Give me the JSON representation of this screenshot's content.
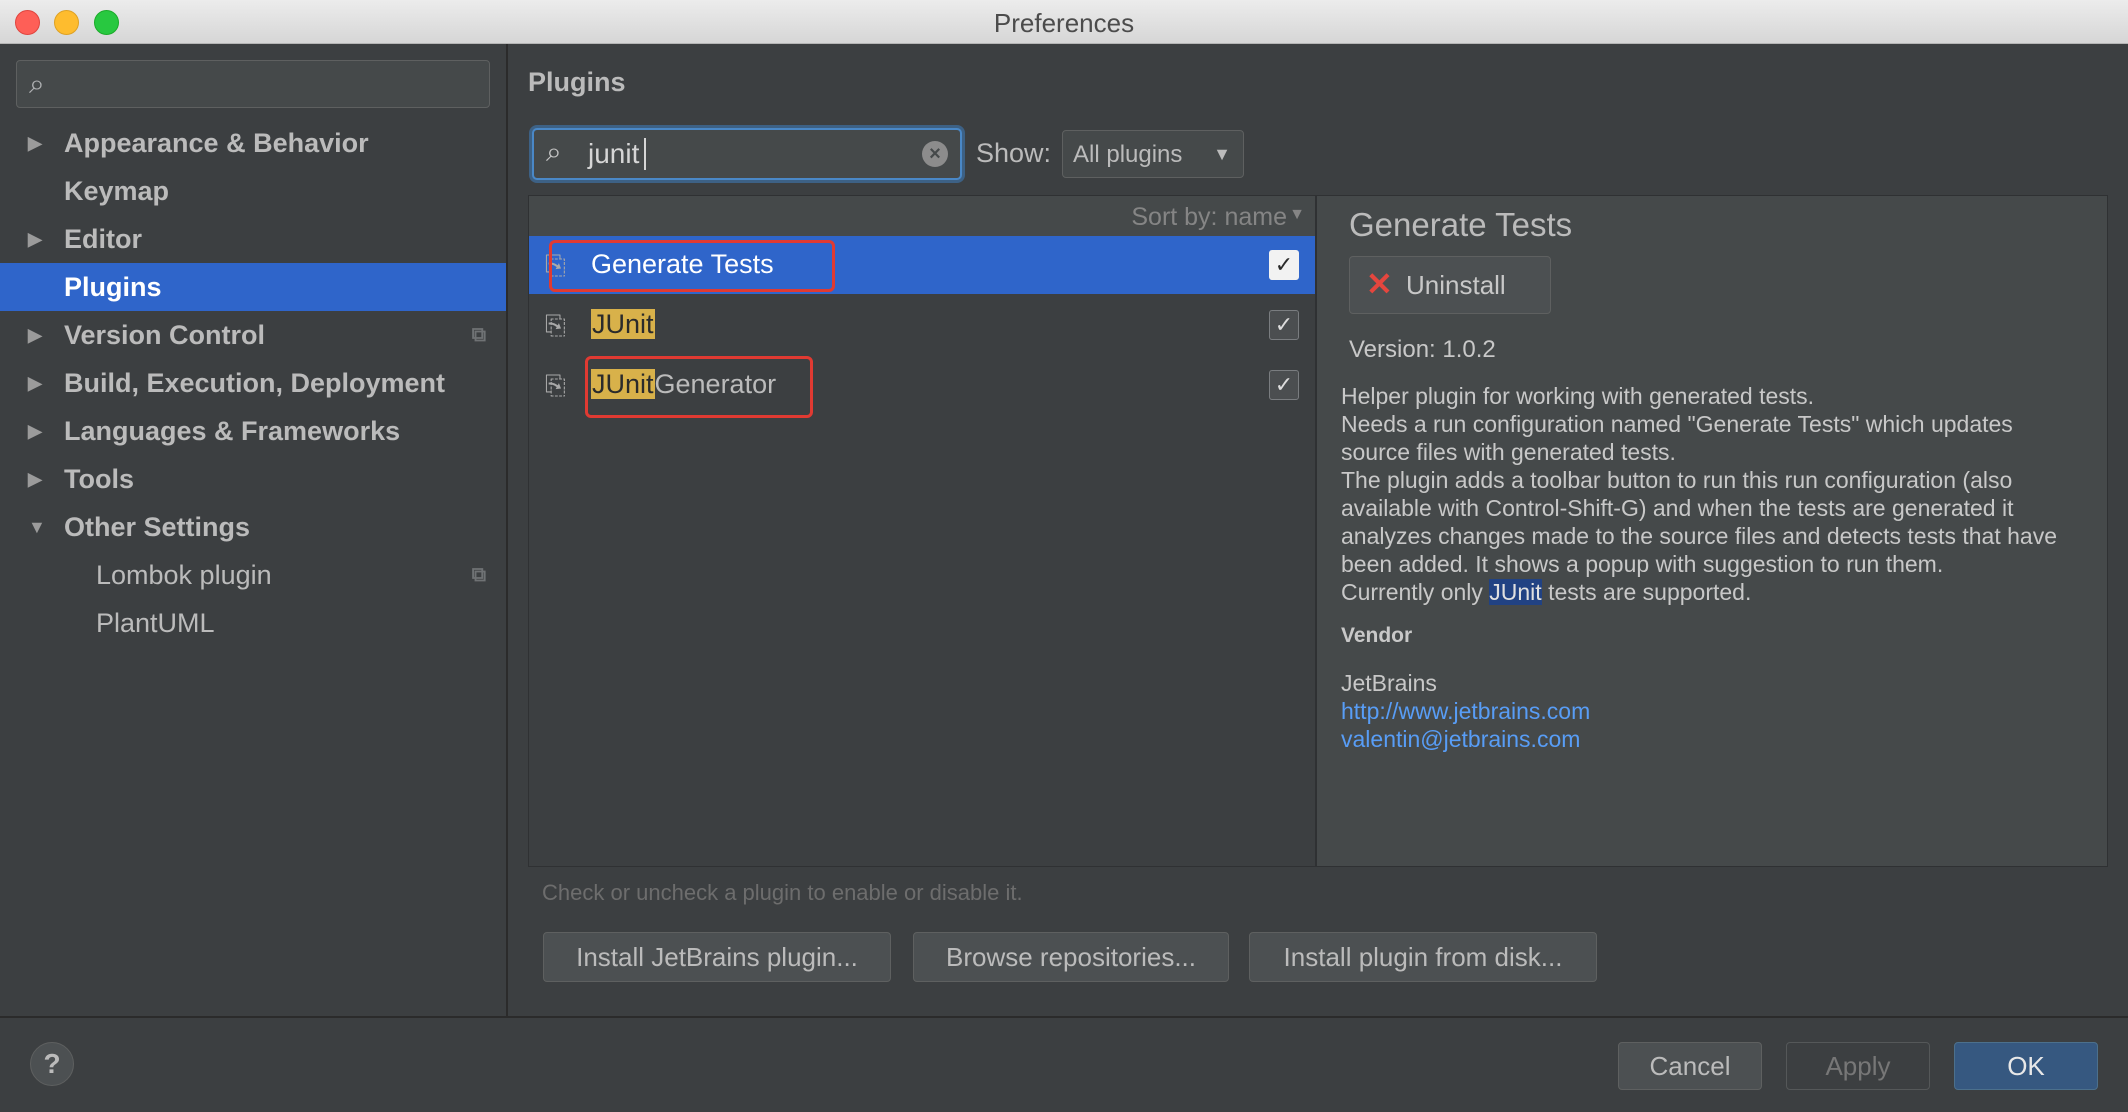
{
  "window": {
    "title": "Preferences"
  },
  "sidebar": {
    "search_placeholder": "",
    "items": [
      {
        "label": "Appearance & Behavior",
        "expandable": true
      },
      {
        "label": "Keymap"
      },
      {
        "label": "Editor",
        "expandable": true
      },
      {
        "label": "Plugins",
        "selected": true
      },
      {
        "label": "Version Control",
        "expandable": true,
        "project_icon": true
      },
      {
        "label": "Build, Execution, Deployment",
        "expandable": true
      },
      {
        "label": "Languages & Frameworks",
        "expandable": true
      },
      {
        "label": "Tools",
        "expandable": true
      },
      {
        "label": "Other Settings",
        "expanded": true
      },
      {
        "label": "Lombok plugin",
        "child": true,
        "project_icon": true
      },
      {
        "label": "PlantUML",
        "child": true
      }
    ]
  },
  "main": {
    "title": "Plugins",
    "search": {
      "value": "junit",
      "highlight": "JUnit"
    },
    "show": {
      "label": "Show:",
      "value": "All plugins"
    },
    "sort": {
      "label": "Sort by: name"
    },
    "plugins": [
      {
        "name": "Generate Tests",
        "checked": true,
        "selected": true
      },
      {
        "name_highlight": "JUnit",
        "name_rest": "",
        "checked": true
      },
      {
        "name_highlight": "JUnit",
        "name_rest": "Generator",
        "checked": true
      }
    ],
    "detail": {
      "title": "Generate Tests",
      "uninstall_label": "Uninstall",
      "version": "Version: 1.0.2",
      "desc_lines": [
        "Helper plugin for working with generated tests.",
        "Needs a run configuration named \"Generate Tests\" which updates source files with generated tests.",
        "The plugin adds a toolbar button to run this run configuration (also available with Control-Shift-G) and when the tests are generated it analyzes changes made to the source files and detects tests that have been added. It shows a popup with suggestion to run them."
      ],
      "desc_last_prefix": "Currently only ",
      "desc_last_highlight": "JUnit",
      "desc_last_suffix": " tests are supported.",
      "vendor_heading": "Vendor",
      "vendor_name": "JetBrains",
      "vendor_url": "http://www.jetbrains.com",
      "vendor_email": "valentin@jetbrains.com"
    },
    "hint": "Check or uncheck a plugin to enable or disable it.",
    "buttons": {
      "install_jetbrains": "Install JetBrains plugin...",
      "browse": "Browse repositories...",
      "install_disk": "Install plugin from disk..."
    }
  },
  "footer": {
    "help": "?",
    "cancel": "Cancel",
    "apply": "Apply",
    "ok": "OK"
  },
  "colors": {
    "accent": "#2f65ca",
    "highlight": "#d8b14a",
    "annotation": "#e03a32",
    "link": "#589df6"
  },
  "icons": [
    "search-icon",
    "clear-icon",
    "plugin-icon",
    "checkbox-icon",
    "uninstall-x-icon",
    "copy-icon",
    "help-icon"
  ]
}
